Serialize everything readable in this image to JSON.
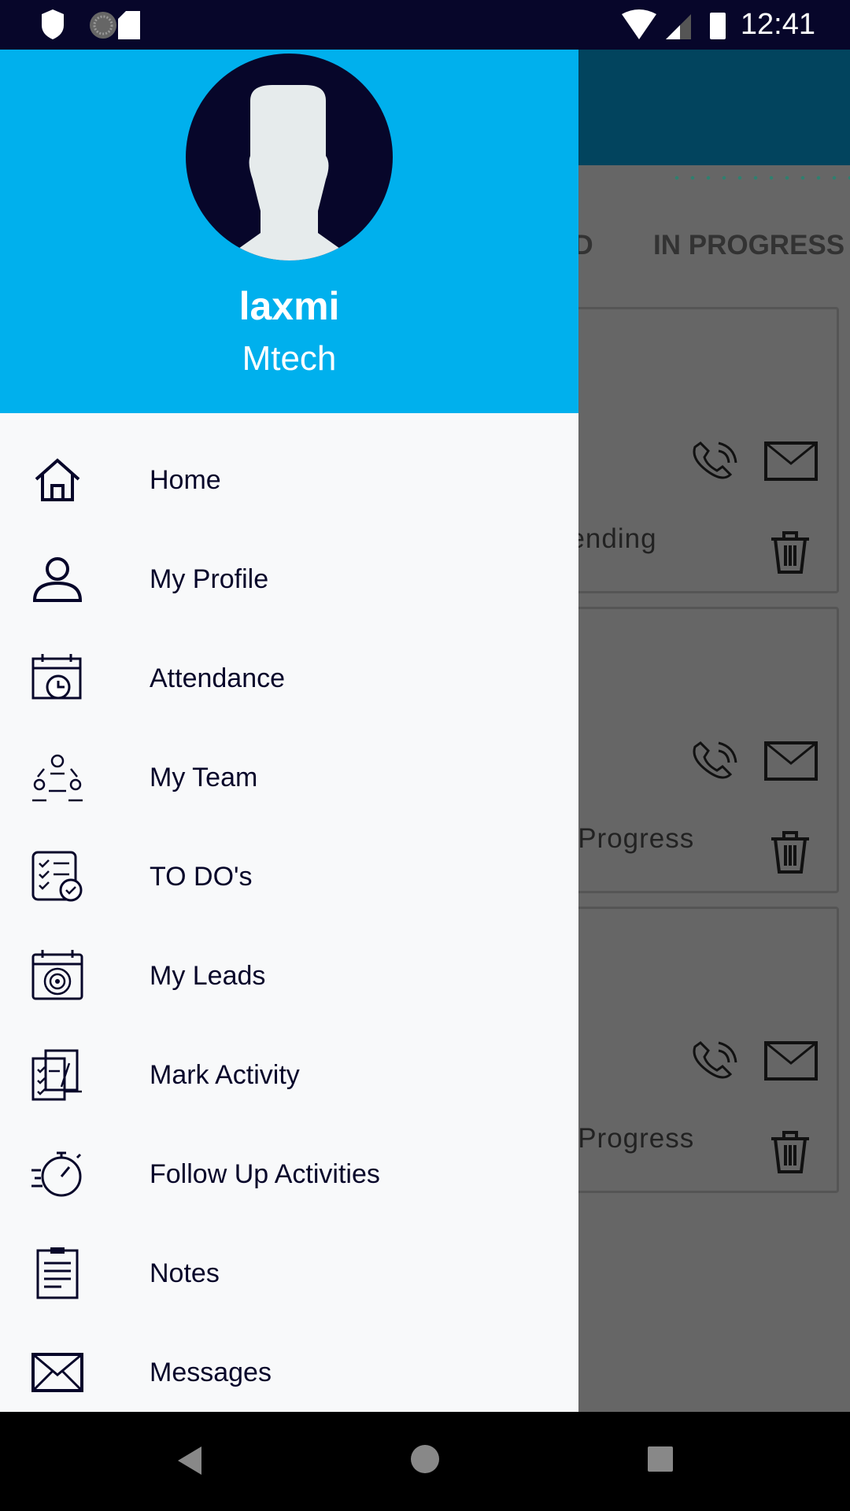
{
  "status_bar": {
    "time": "12:41",
    "icons": [
      "shield-icon",
      "sync-icon",
      "sd-card-icon",
      "wifi-icon",
      "signal-icon",
      "battery-icon"
    ]
  },
  "background": {
    "tabs": [
      "ED",
      "IN PROGRESS"
    ],
    "cards": [
      {
        "status": "pending"
      },
      {
        "status": "n Progress"
      },
      {
        "status": "n Progress"
      }
    ]
  },
  "drawer": {
    "user_name": "laxmi",
    "user_subtitle": "Mtech",
    "items": [
      {
        "label": "Home",
        "icon": "home-icon"
      },
      {
        "label": "My Profile",
        "icon": "user-icon"
      },
      {
        "label": "Attendance",
        "icon": "calendar-clock-icon"
      },
      {
        "label": "My Team",
        "icon": "team-icon"
      },
      {
        "label": "TO DO's",
        "icon": "checklist-icon"
      },
      {
        "label": "My Leads",
        "icon": "target-icon"
      },
      {
        "label": "Mark Activity",
        "icon": "clipboard-pen-icon"
      },
      {
        "label": "Follow Up Activities",
        "icon": "stopwatch-icon"
      },
      {
        "label": "Notes",
        "icon": "notes-icon"
      },
      {
        "label": "Messages",
        "icon": "mail-icon"
      }
    ]
  },
  "colors": {
    "header": "#00b0ed",
    "dark": "#07062a",
    "scrim": "#666666"
  }
}
